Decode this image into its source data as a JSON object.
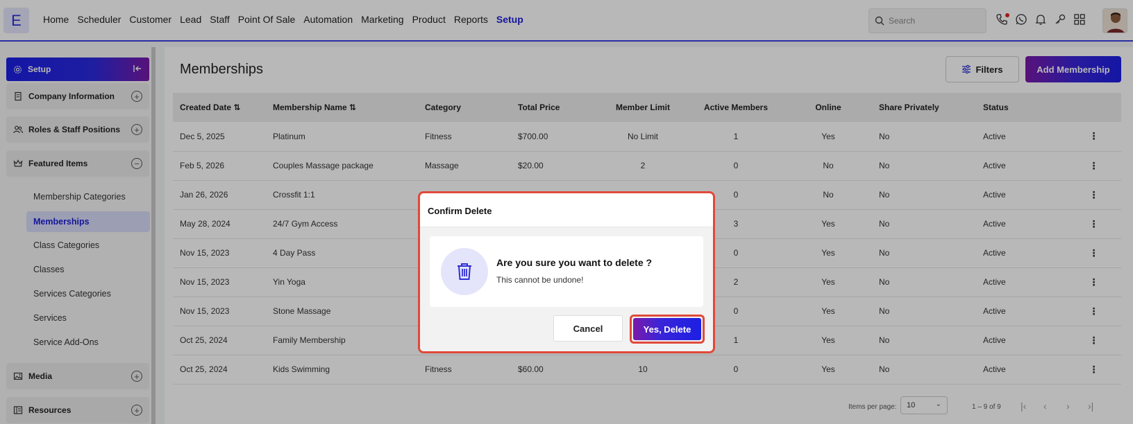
{
  "app": {
    "logo_letter": "E"
  },
  "nav": {
    "items": [
      "Home",
      "Scheduler",
      "Customer",
      "Lead",
      "Staff",
      "Point Of Sale",
      "Automation",
      "Marketing",
      "Product",
      "Reports",
      "Setup"
    ],
    "active": "Setup"
  },
  "search": {
    "placeholder": "Search"
  },
  "top_icons": [
    "phone-icon",
    "whatsapp-icon",
    "bell-icon",
    "key-icon",
    "grid-icon"
  ],
  "sidebar": {
    "header": "Setup",
    "groups": [
      {
        "label": "Company Information",
        "icon": "building-icon",
        "expanded": false
      },
      {
        "label": "Roles & Staff Positions",
        "icon": "users-icon",
        "expanded": false
      },
      {
        "label": "Featured Items",
        "icon": "crown-icon",
        "expanded": true
      },
      {
        "label": "Media",
        "icon": "image-icon",
        "expanded": false
      },
      {
        "label": "Resources",
        "icon": "resources-icon",
        "expanded": false
      }
    ],
    "featured_items": [
      "Membership Categories",
      "Memberships",
      "Class Categories",
      "Classes",
      "Services Categories",
      "Services",
      "Service Add-Ons"
    ],
    "active_item": "Memberships"
  },
  "main": {
    "title": "Memberships",
    "filters_label": "Filters",
    "add_label": "Add Membership"
  },
  "table": {
    "headers": [
      "Created Date",
      "Membership Name",
      "Category",
      "Total Price",
      "Member Limit",
      "Active Members",
      "Online",
      "Share Privately",
      "Status"
    ],
    "rows": [
      [
        "Dec 5, 2025",
        "Platinum",
        "Fitness",
        "$700.00",
        "No Limit",
        "1",
        "Yes",
        "No",
        "Active"
      ],
      [
        "Feb 5, 2026",
        "Couples Massage package",
        "Massage",
        "$20.00",
        "2",
        "0",
        "No",
        "No",
        "Active"
      ],
      [
        "Jan 26, 2026",
        "Crossfit 1:1",
        "",
        "",
        "",
        "0",
        "No",
        "No",
        "Active"
      ],
      [
        "May 28, 2024",
        "24/7 Gym Access",
        "",
        "",
        "",
        "3",
        "Yes",
        "No",
        "Active"
      ],
      [
        "Nov 15, 2023",
        "4 Day Pass",
        "",
        "",
        "",
        "0",
        "Yes",
        "No",
        "Active"
      ],
      [
        "Nov 15, 2023",
        "Yin Yoga",
        "",
        "",
        "",
        "2",
        "Yes",
        "No",
        "Active"
      ],
      [
        "Nov 15, 2023",
        "Stone Massage",
        "",
        "",
        "",
        "0",
        "Yes",
        "No",
        "Active"
      ],
      [
        "Oct 25, 2024",
        "Family Membership",
        "",
        "",
        "",
        "1",
        "Yes",
        "No",
        "Active"
      ],
      [
        "Oct 25, 2024",
        "Kids Swimming",
        "Fitness",
        "$60.00",
        "10",
        "0",
        "Yes",
        "No",
        "Active"
      ]
    ]
  },
  "pager": {
    "items_per_page_label": "Items per page:",
    "items_per_page": "10",
    "range": "1 – 9 of 9"
  },
  "dialog": {
    "title": "Confirm Delete",
    "question": "Are you sure you want to delete ?",
    "subtext": "This cannot be undone!",
    "cancel_label": "Cancel",
    "confirm_label": "Yes, Delete"
  },
  "colors": {
    "accent": "#1c1fe4",
    "accent_purple": "#7b1aa9",
    "highlight_ring": "#e0493a"
  }
}
